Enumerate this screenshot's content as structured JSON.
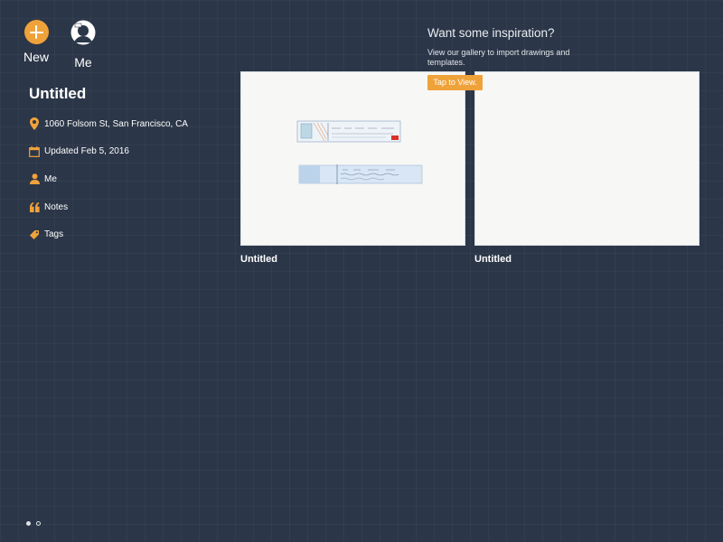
{
  "toolbar": {
    "new_label": "New",
    "me_label": "Me"
  },
  "info": {
    "title": "Untitled",
    "location": "1060 Folsom St, San Francisco, CA",
    "updated": "Updated Feb 5, 2016",
    "author": "Me",
    "notes_label": "Notes",
    "tags_label": "Tags"
  },
  "inspiration": {
    "title": "Want some inspiration?",
    "text": "View our gallery to import drawings and templates.",
    "button_label": "Tap to View."
  },
  "drawings": [
    {
      "name": "Untitled"
    },
    {
      "name": "Untitled"
    }
  ],
  "pager": {
    "pages": 2,
    "current": 1
  },
  "colors": {
    "background": "#2b3648",
    "accent": "#f0a23a",
    "text": "#ffffff"
  },
  "icons": [
    "plus-icon",
    "avatar-icon",
    "location-pin-icon",
    "calendar-icon",
    "person-icon",
    "quote-icon",
    "tag-icon"
  ]
}
